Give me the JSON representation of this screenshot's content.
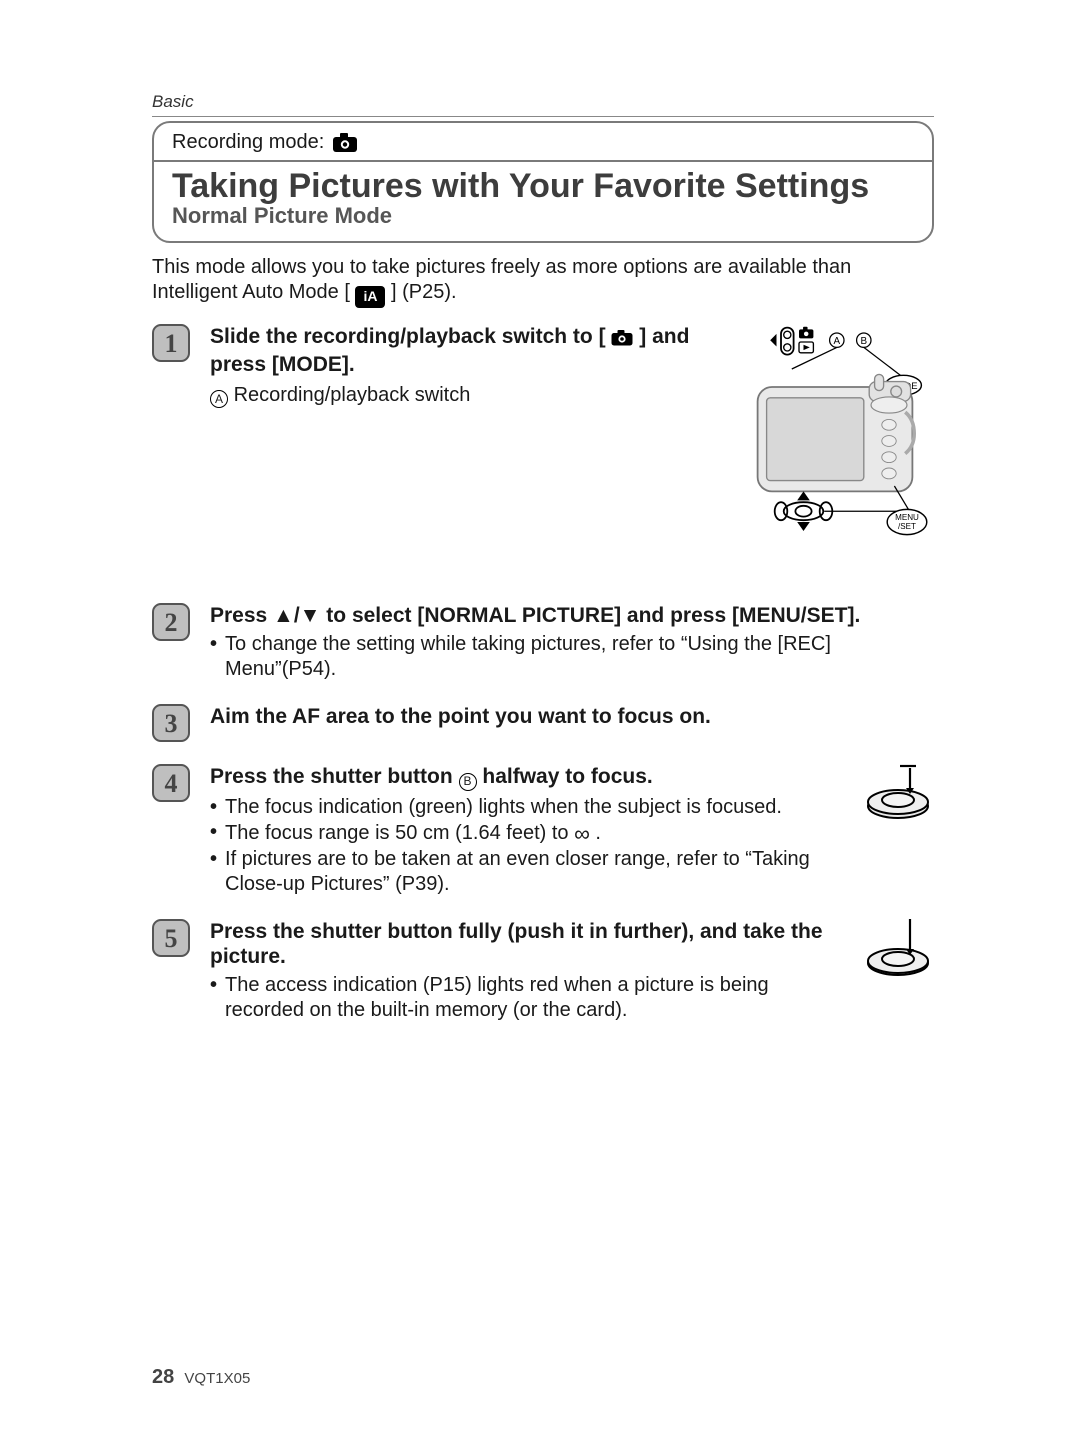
{
  "header": {
    "section_label": "Basic",
    "recording_mode_label": "Recording mode:"
  },
  "title": {
    "main": "Taking Pictures with Your Favorite Settings",
    "sub": "Normal Picture Mode"
  },
  "intro": {
    "line1": "This mode allows you to take pictures freely as more options are available than Intelligent Auto Mode [ ",
    "ia_badge": "iA",
    "line1_tail": " ] (P25)."
  },
  "steps": {
    "s1": {
      "num": "1",
      "head_a": "Slide the recording/playback switch to [",
      "head_b": "] and press [MODE].",
      "sub_label_a": "A",
      "sub_text_a": "Recording/playback switch"
    },
    "s2": {
      "num": "2",
      "head": "Press ▲/▼ to select [NORMAL PICTURE] and press [MENU/SET].",
      "bullet1": "To change the setting while taking pictures, refer to “Using the [REC] Menu”(P54)."
    },
    "s3": {
      "num": "3",
      "head": "Aim the AF area to the point you want to focus on."
    },
    "s4": {
      "num": "4",
      "head_a": "Press the shutter button ",
      "head_label": "B",
      "head_b": " halfway to focus.",
      "bullet1": "The focus indication (green) lights when the subject is focused.",
      "bullet2_a": "The focus range is 50 cm (1.64 feet) to ",
      "bullet2_infty": "∞",
      "bullet2_b": " .",
      "bullet3": "If pictures are to be taken at an even closer range, refer to “Taking Close-up Pictures” (P39)."
    },
    "s5": {
      "num": "5",
      "head": "Press the shutter button fully (push it in further), and take the picture.",
      "bullet1": "The access indication (P15) lights red when a picture is being recorded on the built-in memory (or the card)."
    }
  },
  "illustration": {
    "mode_label": "MODE",
    "menuset_top": "MENU",
    "menuset_bot": "/SET",
    "label_a": "A",
    "label_b": "B"
  },
  "footer": {
    "page_number": "28",
    "doc_code": "VQT1X05"
  },
  "icons": {
    "camera": "camera-icon",
    "ia_badge": "ia-mode-badge",
    "step_number": "step-number-badge",
    "camera_back": "camera-back-illustration",
    "shutter_half": "shutter-half-press-illustration",
    "shutter_full": "shutter-full-press-illustration",
    "infinity": "infinity-icon",
    "circle_a": "callout-label-a",
    "circle_b": "callout-label-b"
  }
}
